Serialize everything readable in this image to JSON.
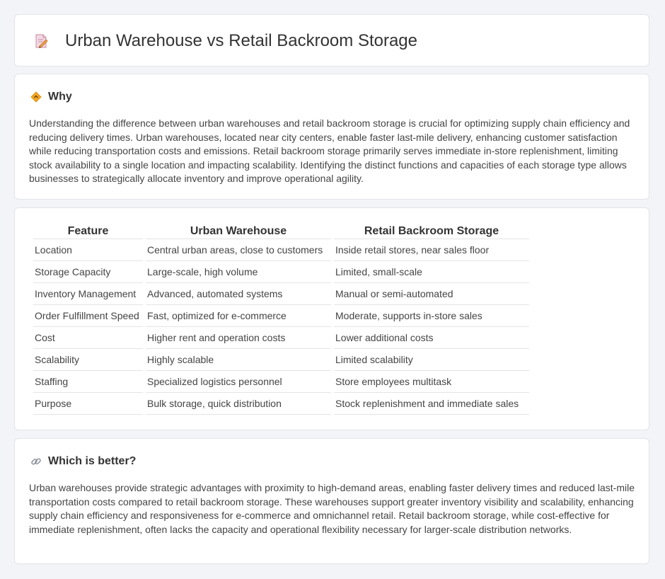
{
  "header": {
    "title": "Urban Warehouse vs Retail Backroom Storage",
    "icon": "document-pencil-icon"
  },
  "why": {
    "heading": "Why",
    "icon": "diamond-arrow-icon",
    "text": "Understanding the difference between urban warehouses and retail backroom storage is crucial for optimizing supply chain efficiency and reducing delivery times. Urban warehouses, located near city centers, enable faster last-mile delivery, enhancing customer satisfaction while reducing transportation costs and emissions. Retail backroom storage primarily serves immediate in-store replenishment, limiting stock availability to a single location and impacting scalability. Identifying the distinct functions and capacities of each storage type allows businesses to strategically allocate inventory and improve operational agility."
  },
  "comparison": {
    "headers": [
      "Feature",
      "Urban Warehouse",
      "Retail Backroom Storage"
    ],
    "rows": [
      [
        "Location",
        "Central urban areas, close to customers",
        "Inside retail stores, near sales floor"
      ],
      [
        "Storage Capacity",
        "Large-scale, high volume",
        "Limited, small-scale"
      ],
      [
        "Inventory Management",
        "Advanced, automated systems",
        "Manual or semi-automated"
      ],
      [
        "Order Fulfillment Speed",
        "Fast, optimized for e-commerce",
        "Moderate, supports in-store sales"
      ],
      [
        "Cost",
        "Higher rent and operation costs",
        "Lower additional costs"
      ],
      [
        "Scalability",
        "Highly scalable",
        "Limited scalability"
      ],
      [
        "Staffing",
        "Specialized logistics personnel",
        "Store employees multitask"
      ],
      [
        "Purpose",
        "Bulk storage, quick distribution",
        "Stock replenishment and immediate sales"
      ]
    ]
  },
  "better": {
    "heading": "Which is better?",
    "icon": "link-icon",
    "text": "Urban warehouses provide strategic advantages with proximity to high-demand areas, enabling faster delivery times and reduced last-mile transportation costs compared to retail backroom storage. These warehouses support greater inventory visibility and scalability, enhancing supply chain efficiency and responsiveness for e-commerce and omnichannel retail. Retail backroom storage, while cost-effective for immediate replenishment, often lacks the capacity and operational flexibility necessary for larger-scale distribution networks."
  }
}
